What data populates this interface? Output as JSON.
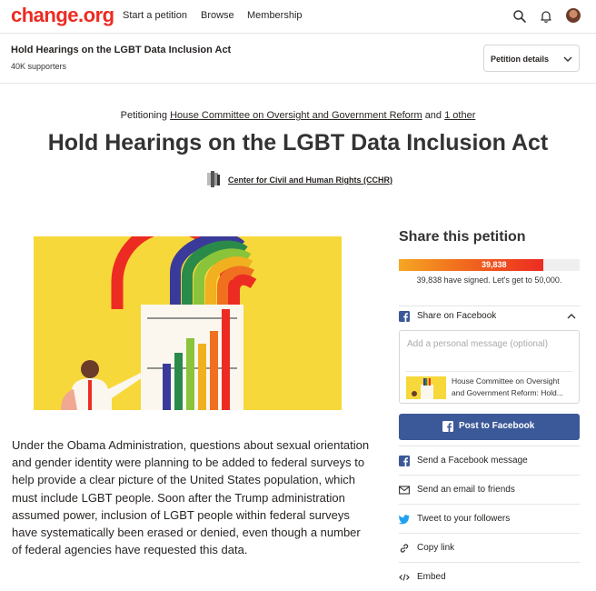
{
  "nav": {
    "logo": "change.org",
    "links": [
      "Start a petition",
      "Browse",
      "Membership"
    ],
    "icons": [
      "search-icon",
      "bell-icon",
      "avatar"
    ]
  },
  "petition_bar": {
    "title": "Hold Hearings on the LGBT Data Inclusion Act",
    "supporters": "40K supporters",
    "details_label": "Petition details"
  },
  "header": {
    "petitioning_prefix": "Petitioning",
    "target": "House Committee on Oversight and Government Reform",
    "and": "and",
    "other": "1 other",
    "title": "Hold Hearings on the LGBT Data Inclusion Act",
    "creator": "Center for Civil and Human Rights (CCHR)"
  },
  "story": "Under the Obama Administration, questions about sexual orientation and gender identity were planning to be added to federal surveys to help provide a clear picture of the United States population, which must include LGBT people. Soon after the Trump administration assumed power, inclusion of LGBT people within federal surveys have systematically been erased or denied, even though a number of federal agencies have requested this data.",
  "sidebar": {
    "share_title": "Share this petition",
    "signed_count": "39,838",
    "progress_fraction": 0.7968,
    "progress_note": "39,838 have signed. Let's get to 50,000.",
    "facebook_header": "Share on Facebook",
    "message_placeholder": "Add a personal message (optional)",
    "preview_text": "House Committee on Oversight and Government Reform: Hold...",
    "post_button": "Post to Facebook",
    "share_options": [
      {
        "label": "Send a Facebook message",
        "icon": "messenger-icon"
      },
      {
        "label": "Send an email to friends",
        "icon": "email-icon"
      },
      {
        "label": "Tweet to your followers",
        "icon": "twitter-icon"
      },
      {
        "label": "Copy link",
        "icon": "link-icon"
      },
      {
        "label": "Embed",
        "icon": "embed-icon"
      }
    ]
  },
  "colors": {
    "brand": "#ec2c22",
    "facebook": "#3b5998",
    "twitter": "#1da1f2",
    "hero_background": "#f7d83a"
  }
}
